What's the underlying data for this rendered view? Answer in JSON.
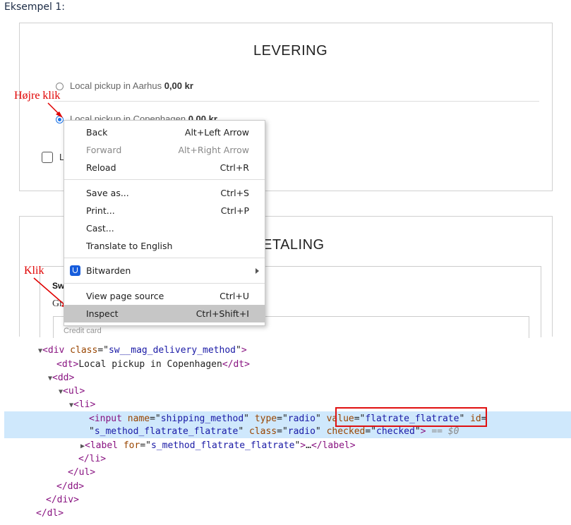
{
  "heading": "Eksempel 1:",
  "delivery": {
    "title": "LEVERING",
    "options": [
      {
        "label": "Local pickup in Aarhus",
        "price": "0,00 kr"
      },
      {
        "label": "Local pickup in Copenhagen",
        "price": "0,00 kr"
      }
    ],
    "checkbox_label": "L"
  },
  "payment": {
    "title_visible": "ETALING",
    "inner_title": "Sw",
    "inner_sub": "Gr",
    "field_label": "Credit card"
  },
  "annotations": {
    "right_click": "Højre  klik",
    "click": "Klik"
  },
  "context_menu": {
    "items": [
      {
        "label": "Back",
        "shortcut": "Alt+Left Arrow"
      },
      {
        "label": "Forward",
        "shortcut": "Alt+Right Arrow"
      },
      {
        "label": "Reload",
        "shortcut": "Ctrl+R"
      },
      {
        "label": "Save as...",
        "shortcut": "Ctrl+S"
      },
      {
        "label": "Print...",
        "shortcut": "Ctrl+P"
      },
      {
        "label": "Cast..."
      },
      {
        "label": "Translate to English"
      },
      {
        "label": "Bitwarden",
        "icon": "bitwarden-icon"
      },
      {
        "label": "View page source",
        "shortcut": "Ctrl+U"
      },
      {
        "label": "Inspect",
        "shortcut": "Ctrl+Shift+I"
      }
    ]
  },
  "devtools": {
    "div_tag": "div",
    "div_class_attr": "class",
    "div_class_val": "sw__mag_delivery_method",
    "dt_text": "Local pickup in Copenhagen",
    "input_name_attr": "name",
    "input_name_val": "shipping_method",
    "input_type_attr": "type",
    "input_type_val": "radio",
    "input_value_attr": "value",
    "input_value_val": "flatrate_flatrate",
    "input_id_attr": "id",
    "input_id_val": "s_method_flatrate_flatrate",
    "input_class_attr": "class",
    "input_class_val": "radio",
    "input_checked_attr": "checked",
    "input_checked_val": "checked",
    "eq": "== $0",
    "label_for_attr": "for",
    "label_for_val": "s_method_flatrate_flatrate"
  },
  "colors": {
    "highlight_row": "#cfe8fc",
    "value_box": "#e01010",
    "annotation": "#e00000"
  }
}
